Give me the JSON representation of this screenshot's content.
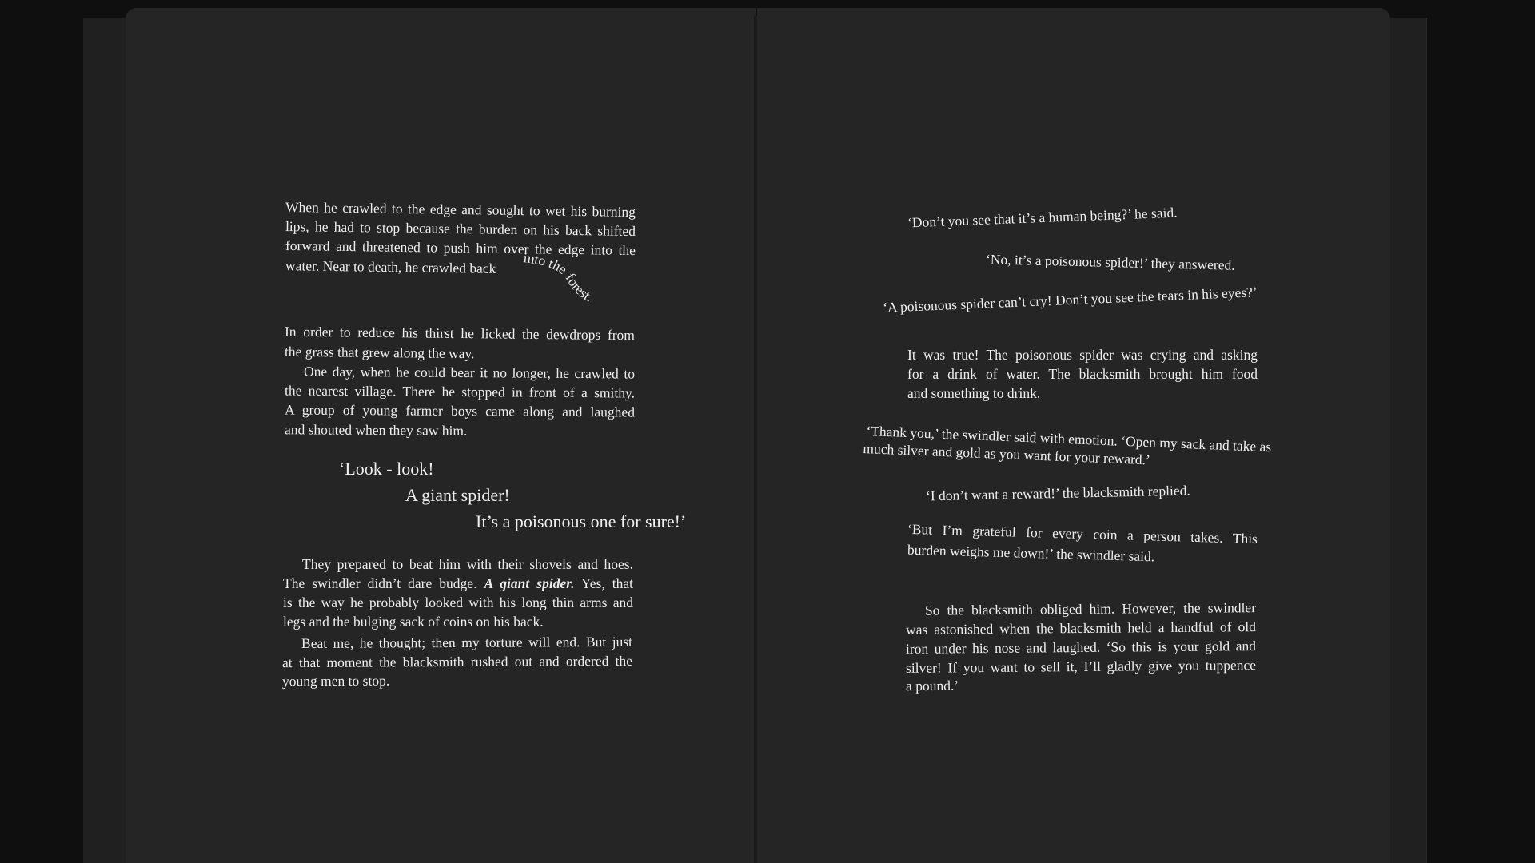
{
  "left_page": {
    "para1_lines": [
      "When he crawled to the edge and sought to wet his burning",
      "lips, he had to stop because the burden on his back shifted",
      "forward and threatened to push him over the edge into the"
    ],
    "para1_last": "water. Near to death, he crawled back",
    "para1_curve": "into the forest.",
    "para2_lines": [
      "In order to reduce his thirst he licked the dewdrops from",
      "the grass that grew along the way."
    ],
    "para3_lines": [
      "One day, when he could bear it no longer, he crawled to",
      "the nearest village. There he stopped in front of a smithy.",
      "A group of young farmer boys came along and laughed",
      "and shouted when they saw him."
    ],
    "shout1": "‘Look - look!",
    "shout2": "A giant spider!",
    "shout3": "It’s a poisonous one for sure!’",
    "para4_line1": "They prepared to beat him with their shovels and hoes.",
    "para4_line2_a": "The swindler didn’t dare budge. ",
    "para4_line2_em": "A giant spider.",
    "para4_line2_b": " Yes, that",
    "para4_lines_rest": [
      "is the way he probably looked with his long thin arms and",
      "legs and the bulging sack of coins on his back."
    ],
    "para5_lines": [
      "Beat me, he thought; then my torture will end. But just",
      "at that moment the blacksmith rushed out and ordered the",
      "young men to stop."
    ]
  },
  "right_page": {
    "q1": "‘Don’t you see that it’s a human being?’ he said.",
    "q2": "‘No, it’s a poisonous spider!’ they answered.",
    "q3": "‘A poisonous spider can’t cry! Don’t you see the tears in his eyes?’",
    "p1_lines": [
      "It was true! The poisonous spider was crying and asking",
      "for a drink of water. The blacksmith brought him food",
      "and something to drink."
    ],
    "q4_line1": "‘Thank you,’ the swindler said with emotion. ‘Open my sack and take as",
    "q4_line2": "much silver and gold as you want for your reward.’",
    "q5": "‘I don’t want a reward!’ the blacksmith replied.",
    "q6_line1": "‘But I’m grateful for every coin a person takes. This",
    "q6_line2": "burden weighs me down!’ the swindler said.",
    "p2_lines": [
      "So the blacksmith obliged him. However, the swindler",
      "was astonished when the blacksmith held a handful of old",
      "iron under his nose and laughed. ‘So this is your gold and",
      "silver! If you want to sell it, I’ll gladly give you tuppence",
      "a pound.’"
    ]
  }
}
